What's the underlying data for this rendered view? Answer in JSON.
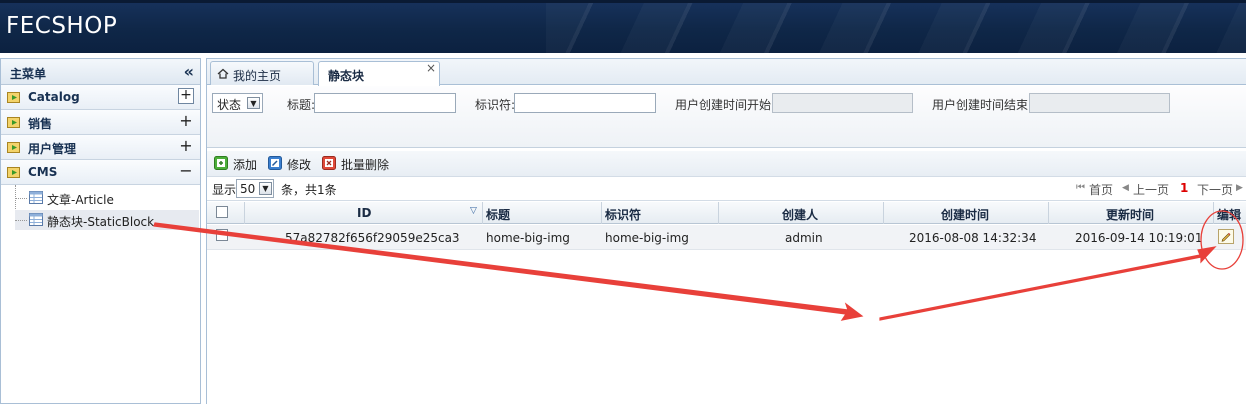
{
  "app": {
    "logo": "FECSHOP"
  },
  "sidebar": {
    "title": "主菜单",
    "collapse_symbol": "«",
    "sections": [
      {
        "label": "Catalog",
        "toggle": "+"
      },
      {
        "label": "销售",
        "toggle": "+"
      },
      {
        "label": "用户管理",
        "toggle": "+"
      },
      {
        "label": "CMS",
        "toggle": "−"
      }
    ],
    "cms_items": [
      {
        "label": "文章-Article"
      },
      {
        "label": "静态块-StaticBlock"
      }
    ]
  },
  "tabs": [
    {
      "label": "我的主页"
    },
    {
      "label": "静态块",
      "close": "×"
    }
  ],
  "search": {
    "status_select": "状态",
    "select_arrow": "▼",
    "title_label": "标题:",
    "identifier_label": "标识符:",
    "created_start_label": "用户创建时间开始",
    "created_end_label": "用户创建时间结束"
  },
  "toolbar": {
    "add": "添加",
    "edit": "修改",
    "batch_delete": "批量删除"
  },
  "pager": {
    "show_label": "显示",
    "page_size": "50",
    "count_text": "条，共1条",
    "first": "首页",
    "prev": "上一页",
    "current": "1",
    "next": "下一页",
    "first_arrow": "⏮",
    "prev_arrow": "◀",
    "next_arrow": "▶"
  },
  "table": {
    "columns": [
      "ID",
      "标题",
      "标识符",
      "创建人",
      "创建时间",
      "更新时间",
      "编辑"
    ],
    "rows": [
      {
        "id": "57a82782f656f29059e25ca3",
        "title": "home-big-img",
        "identifier": "home-big-img",
        "creator": "admin",
        "created_at": "2016-08-08 14:32:34",
        "updated_at": "2016-09-14 10:19:01"
      }
    ]
  },
  "colors": {
    "header_bg": "#0f2748",
    "annotation": "#e8403a",
    "pager_current": "#dd0000"
  }
}
